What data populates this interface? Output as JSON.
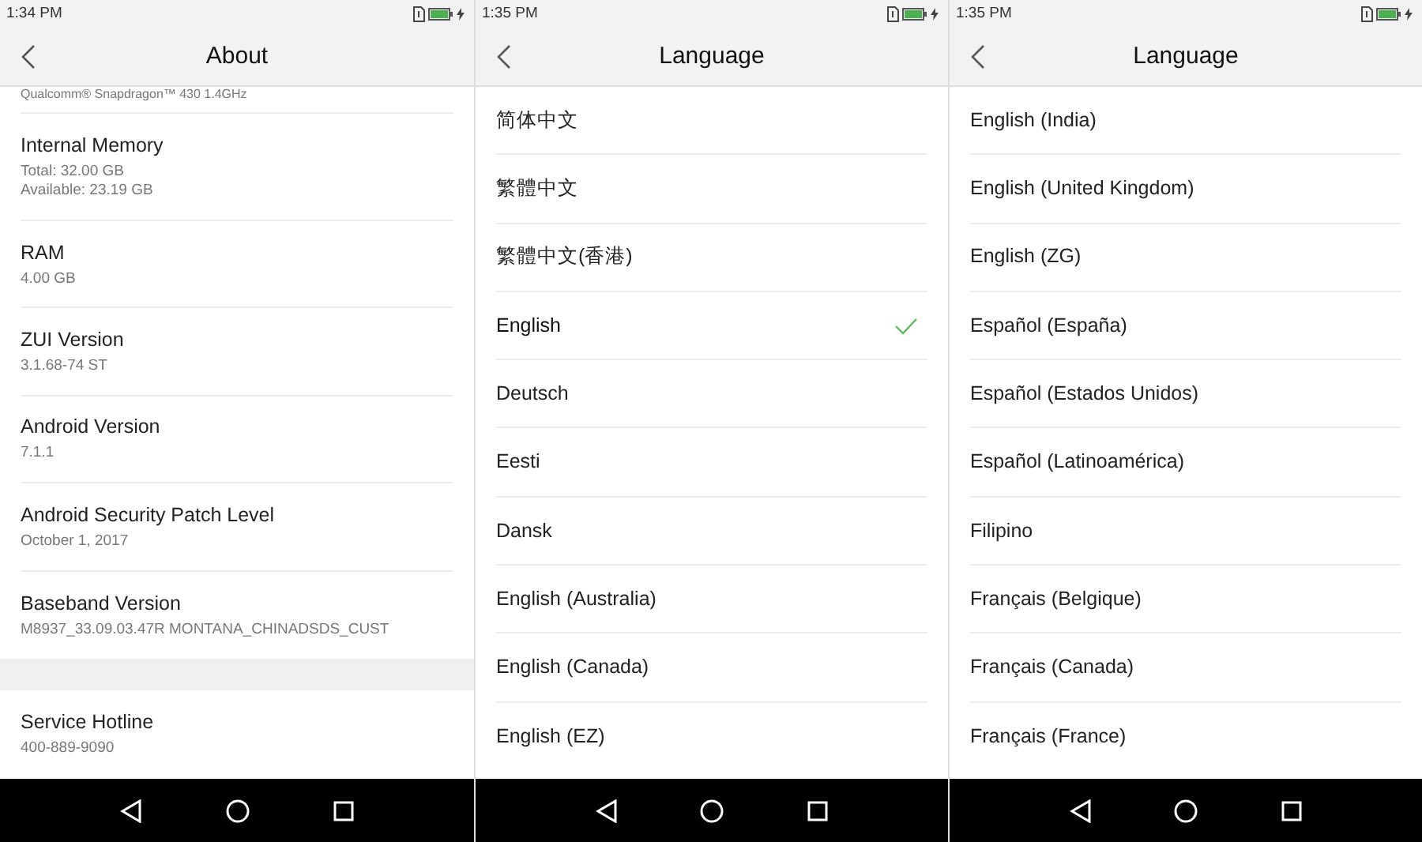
{
  "screens": [
    {
      "kind": "about",
      "status_bar": {
        "time": "1:34 PM"
      },
      "title": "About",
      "cut_line": "Qualcomm® Snapdragon™ 430 1.4GHz",
      "items": [
        {
          "kind": "info",
          "label": "Internal Memory",
          "values": [
            "Total: 32.00 GB",
            "Available: 23.19 GB"
          ]
        },
        {
          "kind": "info",
          "label": "RAM",
          "values": [
            "4.00 GB"
          ]
        },
        {
          "kind": "info",
          "label": "ZUI Version",
          "values": [
            "3.1.68-74 ST"
          ]
        },
        {
          "kind": "info",
          "label": "Android Version",
          "values": [
            "7.1.1"
          ]
        },
        {
          "kind": "info",
          "label": "Android Security Patch Level",
          "values": [
            "October 1, 2017"
          ]
        },
        {
          "kind": "info",
          "label": "Baseband Version",
          "values": [
            "M8937_33.09.03.47R MONTANA_CHINADSDS_CUST"
          ]
        },
        {
          "kind": "gap"
        },
        {
          "kind": "info",
          "label": "Service Hotline",
          "values": [
            "400-889-9090"
          ]
        }
      ]
    },
    {
      "kind": "language",
      "status_bar": {
        "time": "1:35 PM"
      },
      "title": "Language",
      "items": [
        {
          "label": "简体中文",
          "selected": false
        },
        {
          "label": "繁體中文",
          "selected": false
        },
        {
          "label": "繁體中文(香港)",
          "selected": false
        },
        {
          "label": "English",
          "selected": true
        },
        {
          "label": "Deutsch",
          "selected": false
        },
        {
          "label": "Eesti",
          "selected": false
        },
        {
          "label": "Dansk",
          "selected": false
        },
        {
          "label": "English (Australia)",
          "selected": false
        },
        {
          "label": "English (Canada)",
          "selected": false
        },
        {
          "label": "English (EZ)",
          "selected": false
        }
      ]
    },
    {
      "kind": "language",
      "status_bar": {
        "time": "1:35 PM"
      },
      "title": "Language",
      "items": [
        {
          "label": "English (India)",
          "selected": false
        },
        {
          "label": "English (United Kingdom)",
          "selected": false
        },
        {
          "label": "English (ZG)",
          "selected": false
        },
        {
          "label": "Español (España)",
          "selected": false
        },
        {
          "label": "Español (Estados Unidos)",
          "selected": false
        },
        {
          "label": "Español (Latinoamérica)",
          "selected": false
        },
        {
          "label": "Filipino",
          "selected": false
        },
        {
          "label": "Français (Belgique)",
          "selected": false
        },
        {
          "label": "Français (Canada)",
          "selected": false
        },
        {
          "label": "Français (France)",
          "selected": false
        }
      ]
    }
  ]
}
